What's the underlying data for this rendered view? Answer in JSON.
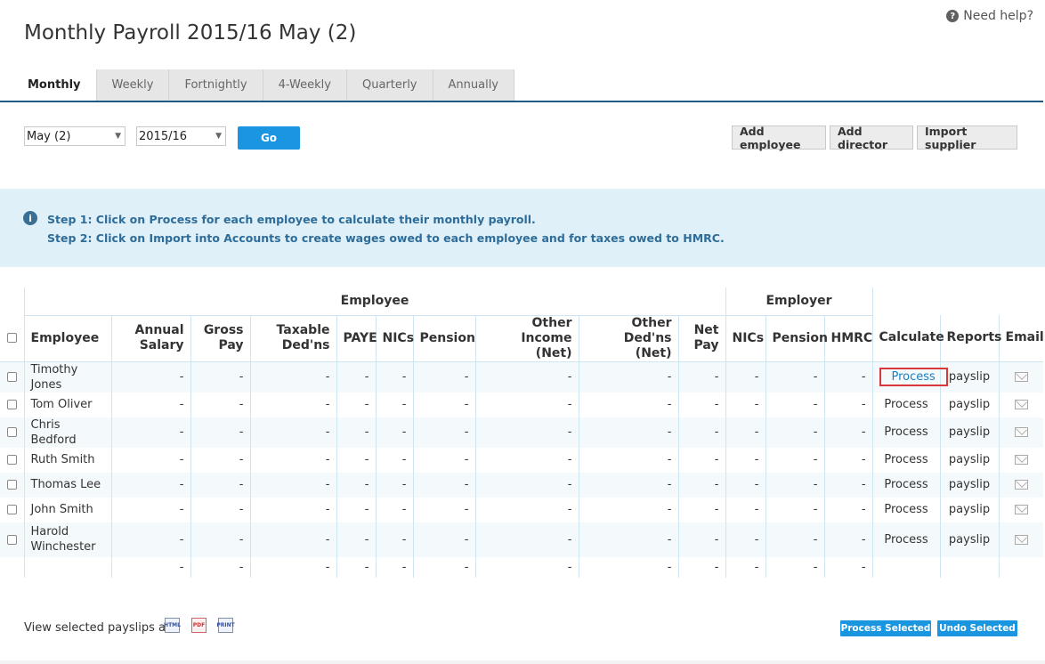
{
  "help": {
    "label": "Need help?",
    "icon": "question-circle-icon"
  },
  "page_title": "Monthly Payroll 2015/16 May (2)",
  "tabs": [
    {
      "label": "Monthly",
      "active": true
    },
    {
      "label": "Weekly"
    },
    {
      "label": "Fortnightly"
    },
    {
      "label": "4-Weekly"
    },
    {
      "label": "Quarterly"
    },
    {
      "label": "Annually"
    }
  ],
  "filters": {
    "period": "May (2)",
    "year": "2015/16",
    "go_label": "Go"
  },
  "actions": {
    "add_employee": "Add employee",
    "add_director": "Add director",
    "import_supplier": "Import supplier"
  },
  "info": {
    "icon": "info-circle-icon",
    "step1": "Step 1: Click on Process for each employee to calculate their monthly payroll.",
    "step2": "Step 2: Click on Import into Accounts to create wages owed to each employee and for taxes owed to HMRC."
  },
  "table": {
    "group_employee": "Employee",
    "group_employer": "Employer",
    "headers": {
      "employee": "Employee",
      "annual_salary": [
        "Annual",
        "Salary"
      ],
      "gross_pay": [
        "Gross",
        "Pay"
      ],
      "taxable_deds": [
        "Taxable",
        "Ded'ns"
      ],
      "paye": "PAYE",
      "nics": "NICs",
      "pension": "Pension",
      "other_income": [
        "Other Income",
        "(Net)"
      ],
      "other_deds": [
        "Other Ded'ns",
        "(Net)"
      ],
      "net_pay": [
        "Net",
        "Pay"
      ],
      "er_nics": "NICs",
      "er_pension": "Pension",
      "hmrc": "HMRC",
      "calculate": "Calculate",
      "reports": "Reports",
      "email": "Email"
    },
    "rows": [
      {
        "name": [
          "Timothy Jones"
        ],
        "process": "Process",
        "report": "payslip",
        "highlighted": true
      },
      {
        "name": [
          "Tom Oliver"
        ],
        "process": "Process",
        "report": "payslip"
      },
      {
        "name": [
          "Chris Bedford"
        ],
        "process": "Process",
        "report": "payslip"
      },
      {
        "name": [
          "Ruth Smith"
        ],
        "process": "Process",
        "report": "payslip"
      },
      {
        "name": [
          "Thomas Lee"
        ],
        "process": "Process",
        "report": "payslip"
      },
      {
        "name": [
          "John Smith"
        ],
        "process": "Process",
        "report": "payslip"
      },
      {
        "name": [
          "Harold",
          "Winchester"
        ],
        "process": "Process",
        "report": "payslip"
      }
    ],
    "empty_value": "-"
  },
  "footer": {
    "view_label": "View selected payslips as:",
    "formats": [
      "HTML",
      "PDF",
      "PRINT"
    ],
    "process_selected": "Process Selected",
    "undo_selected": "Undo Selected"
  }
}
